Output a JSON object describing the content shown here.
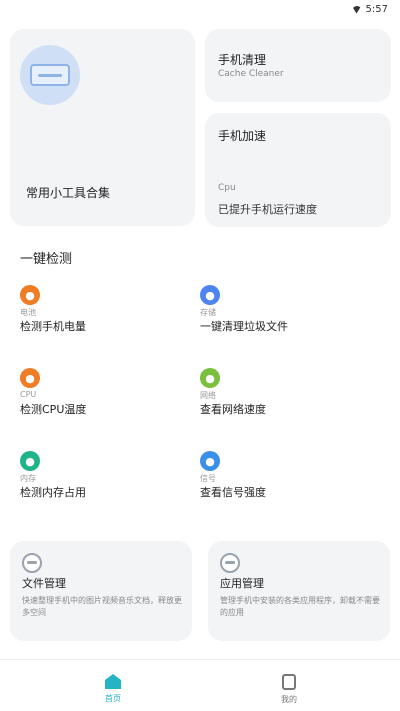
{
  "status_bar": {
    "time": "5:57",
    "wifi_icon": "wifi-icon",
    "battery_icon": "battery-icon"
  },
  "tool_card": {
    "icon": "device-screen-icon",
    "title": "常用小工具合集"
  },
  "small_cards": [
    {
      "title": "手机清理",
      "subtitle": "Cache Cleaner"
    },
    {
      "title": "手机加速",
      "subtitle": "Cpu",
      "value": "已提升手机运行速度"
    }
  ],
  "section": {
    "title": "一键检测",
    "items": [
      {
        "tag": "电池",
        "label": "检测手机电量",
        "color": "#f07c23",
        "icon": "battery-check-icon"
      },
      {
        "tag": "存储",
        "label": "一键清理垃圾文件",
        "color": "#4f84f0",
        "icon": "storage-icon"
      },
      {
        "tag": "CPU",
        "label": "检测CPU温度",
        "color": "#f07c23",
        "icon": "cpu-icon"
      },
      {
        "tag": "网络",
        "label": "查看网络速度",
        "color": "#7ac03d",
        "icon": "network-icon"
      },
      {
        "tag": "内存",
        "label": "检测内存占用",
        "color": "#1fb38a",
        "icon": "memory-icon"
      },
      {
        "tag": "信号",
        "label": "查看信号强度",
        "color": "#3a8fe8",
        "icon": "signal-icon"
      }
    ]
  },
  "bottom_cards": [
    {
      "title": "文件管理",
      "desc": "快速整理手机中的图片视频音乐文档，释放更多空间"
    },
    {
      "title": "应用管理",
      "desc": "管理手机中安装的各类应用程序，卸载不需要的应用"
    }
  ],
  "nav": {
    "home_label": "首页",
    "mine_label": "我的",
    "home_icon": "home-icon",
    "mine_icon": "profile-icon"
  }
}
